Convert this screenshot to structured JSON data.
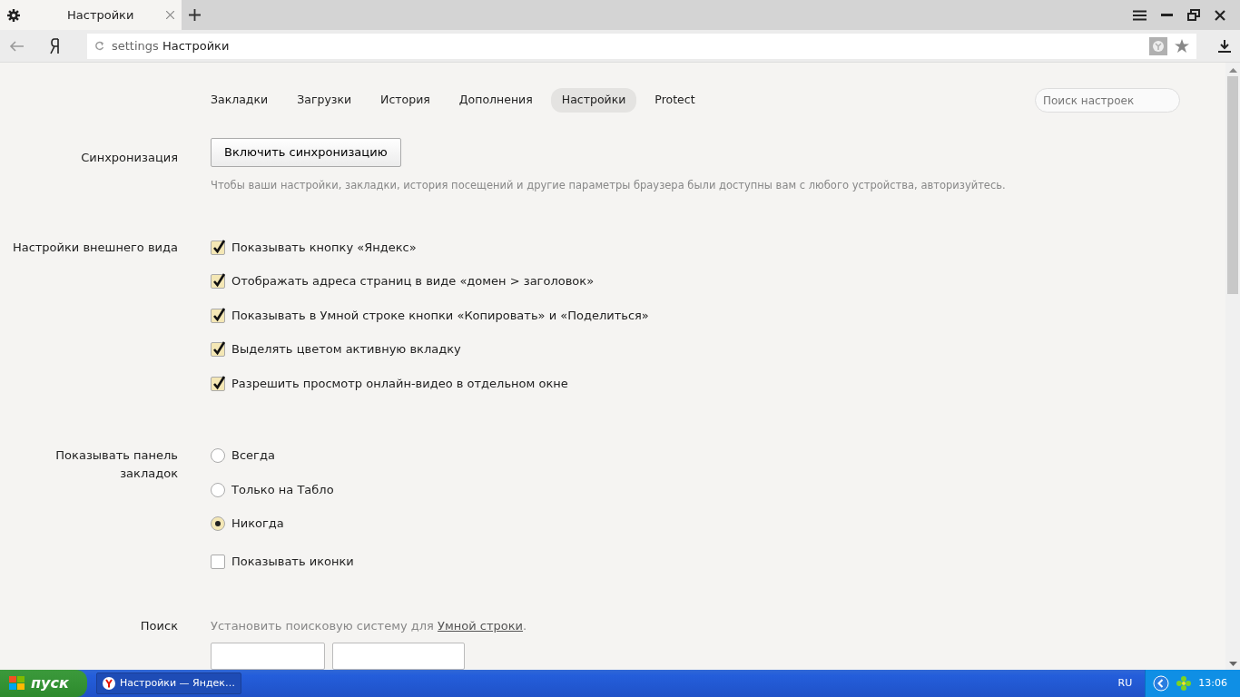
{
  "browser": {
    "tab_title": "Настройки",
    "address_prefix": "settings",
    "address_title": "Настройки"
  },
  "settings_nav": [
    {
      "label": "Закладки",
      "selected": false
    },
    {
      "label": "Загрузки",
      "selected": false
    },
    {
      "label": "История",
      "selected": false
    },
    {
      "label": "Дополнения",
      "selected": false
    },
    {
      "label": "Настройки",
      "selected": true
    },
    {
      "label": "Protect",
      "selected": false
    }
  ],
  "search": {
    "placeholder": "Поиск настроек"
  },
  "sections": [
    {
      "kind": "sync",
      "label": "Синхронизация",
      "button": "Включить синхронизацию",
      "hint": "Чтобы ваши настройки, закладки, история посещений и другие параметры браузера были доступны вам с любого устройства, авторизуйтесь."
    },
    {
      "kind": "options",
      "label": "Настройки внешнего вида",
      "options": [
        {
          "kind": "checkbox",
          "label": "Показывать кнопку «Яндекс»",
          "checked": true
        },
        {
          "kind": "checkbox",
          "label": "Отображать адреса страниц в виде «домен > заголовок»",
          "checked": true
        },
        {
          "kind": "checkbox",
          "label": "Показывать в Умной строке кнопки «Копировать» и «Поделиться»",
          "checked": true
        },
        {
          "kind": "checkbox",
          "label": "Выделять цветом активную вкладку",
          "checked": true
        },
        {
          "kind": "checkbox",
          "label": "Разрешить просмотр онлайн-видео в отдельном окне",
          "checked": true
        }
      ]
    },
    {
      "kind": "options",
      "label": "Показывать панель закладок",
      "options": [
        {
          "kind": "radio",
          "label": "Всегда",
          "selected": false
        },
        {
          "kind": "radio",
          "label": "Только на Табло",
          "selected": false
        },
        {
          "kind": "radio",
          "label": "Никогда",
          "selected": true
        },
        {
          "kind": "checkbox",
          "label": "Показывать иконки",
          "checked": false
        }
      ]
    },
    {
      "kind": "search",
      "label": "Поиск",
      "text": "Установить поисковую систему для",
      "link": "Умной строки",
      "suffix": "."
    }
  ],
  "taskbar": {
    "start": "пуск",
    "task": "Настройки — Яндек…",
    "language": "RU",
    "clock": "13:06"
  }
}
